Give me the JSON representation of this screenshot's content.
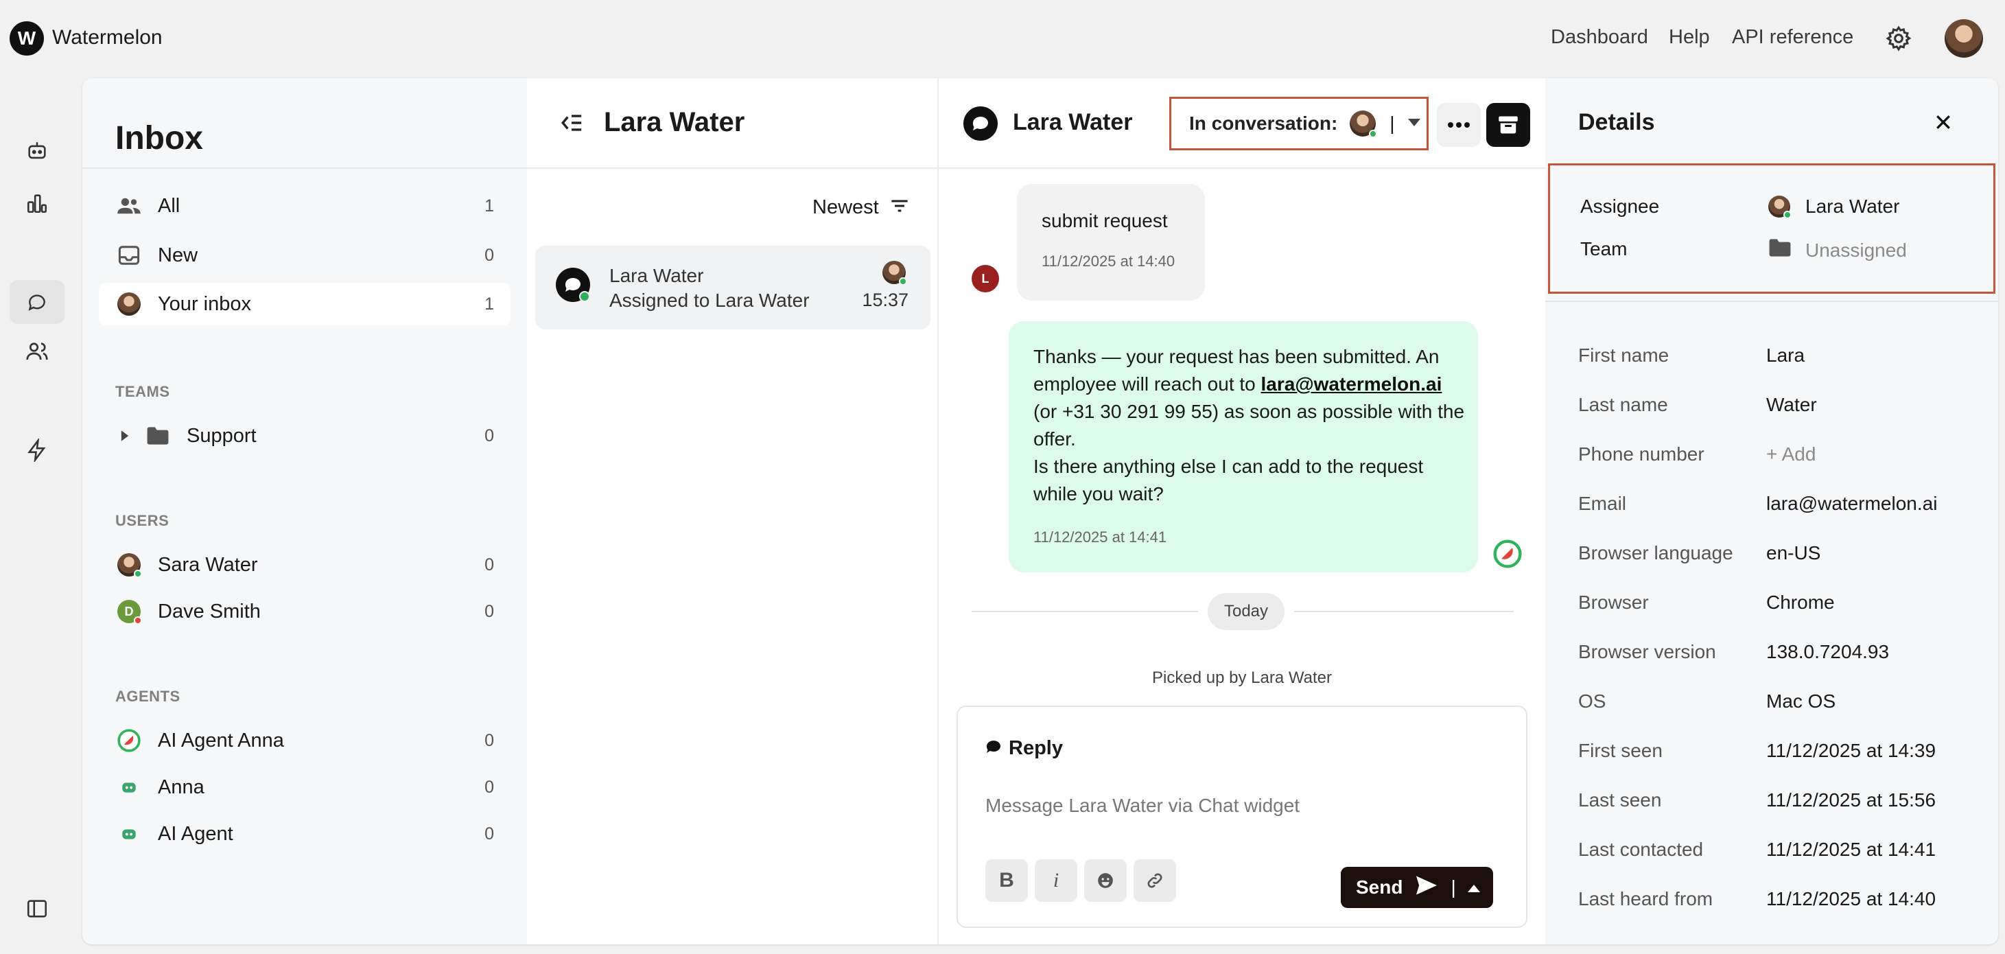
{
  "app": {
    "brand": "Watermelon",
    "logo_letter": "W",
    "nav": [
      "Dashboard",
      "Help",
      "API reference"
    ]
  },
  "inbox": {
    "title": "Inbox",
    "items": [
      {
        "label": "All",
        "count": "1"
      },
      {
        "label": "New",
        "count": "0"
      },
      {
        "label": "Your inbox",
        "count": "1"
      }
    ],
    "teams_heading": "TEAMS",
    "teams": [
      {
        "label": "Support",
        "count": "0"
      }
    ],
    "users_heading": "USERS",
    "users": [
      {
        "label": "Sara Water",
        "count": "0",
        "initial": ""
      },
      {
        "label": "Dave Smith",
        "count": "0",
        "initial": "D"
      }
    ],
    "agents_heading": "AGENTS",
    "agents": [
      {
        "label": "AI Agent Anna",
        "count": "0"
      },
      {
        "label": "Anna",
        "count": "0"
      },
      {
        "label": "AI Agent",
        "count": "0"
      }
    ]
  },
  "conversation_list": {
    "title": "Lara Water",
    "sort_label": "Newest",
    "items": [
      {
        "name": "Lara Water",
        "subtitle": "Assigned to Lara Water",
        "time": "15:37"
      }
    ]
  },
  "chat": {
    "title": "Lara Water",
    "status_label": "In conversation:",
    "status_separator": "|",
    "user_initial": "L",
    "messages": [
      {
        "text": "submit request",
        "time": "11/12/2025 at 14:40"
      },
      {
        "line1": "Thanks — your request has been submitted. An",
        "line2_pre": "employee will reach out to ",
        "email": "lara@watermelon.ai",
        "line3": "(or +31 30 291 99 55) as soon as possible with the",
        "line4": "offer.",
        "line5": "Is there anything else I can add to the request",
        "line6": "while you wait?",
        "time": "11/12/2025 at 14:41"
      }
    ],
    "divider": "Today",
    "event": "Picked up by Lara Water",
    "reply": {
      "label": "Reply",
      "placeholder": "Message Lara Water via Chat widget",
      "bold": "B",
      "italic": "i",
      "send": "Send",
      "send_separator": "|"
    }
  },
  "details": {
    "title": "Details",
    "assignee_label": "Assignee",
    "assignee_value": "Lara Water",
    "team_label": "Team",
    "team_value": "Unassigned",
    "fields": [
      {
        "label": "First name",
        "value": "Lara"
      },
      {
        "label": "Last name",
        "value": "Water"
      },
      {
        "label": "Phone number",
        "value": "+ Add",
        "muted": true
      },
      {
        "label": "Email",
        "value": "lara@watermelon.ai"
      },
      {
        "label": "Browser language",
        "value": "en-US"
      },
      {
        "label": "Browser",
        "value": "Chrome"
      },
      {
        "label": "Browser version",
        "value": "138.0.7204.93"
      },
      {
        "label": "OS",
        "value": "Mac OS"
      },
      {
        "label": "First seen",
        "value": "11/12/2025 at 14:39"
      },
      {
        "label": "Last seen",
        "value": "11/12/2025 at 15:56"
      },
      {
        "label": "Last contacted",
        "value": "11/12/2025 at 14:41"
      },
      {
        "label": "Last heard from",
        "value": "11/12/2025 at 14:40"
      }
    ]
  },
  "colors": {
    "accent_highlight": "#c4573a",
    "online": "#2fb35a",
    "bot_bubble": "#dcfbea",
    "send_button": "#1a0f0a"
  }
}
